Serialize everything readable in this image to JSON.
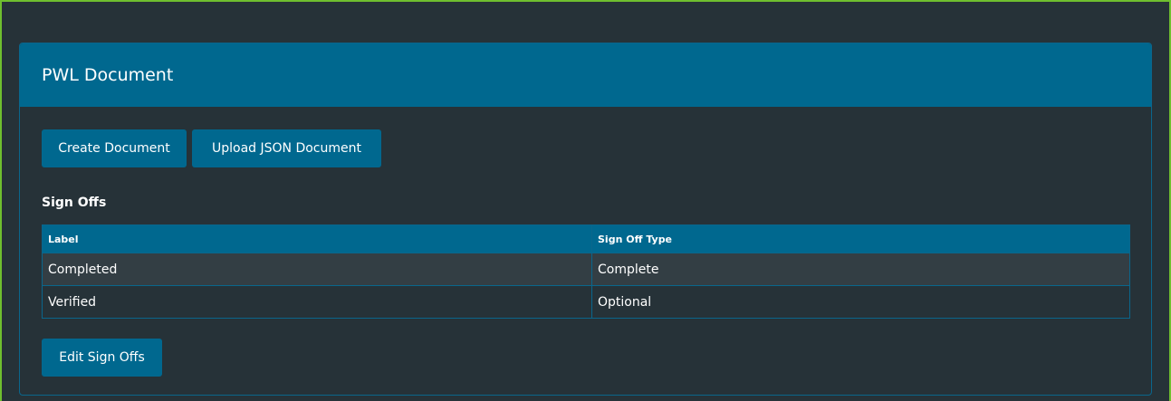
{
  "panel": {
    "title": "PWL Document"
  },
  "toolbar": {
    "create_label": "Create Document",
    "upload_label": "Upload JSON Document"
  },
  "signoffs": {
    "section_title": "Sign Offs",
    "columns": [
      "Label",
      "Sign Off Type"
    ],
    "rows": [
      {
        "label": "Completed",
        "type": "Complete"
      },
      {
        "label": "Verified",
        "type": "Optional"
      }
    ],
    "edit_label": "Edit Sign Offs"
  },
  "colors": {
    "accent": "#00688f",
    "background": "#263238",
    "row_alt": "#333e44",
    "frame_border": "#6fbf2f"
  }
}
